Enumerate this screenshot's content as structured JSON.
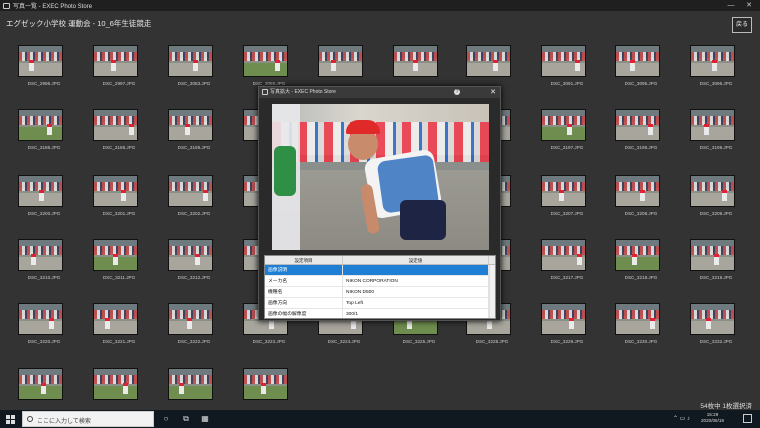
{
  "window": {
    "title": "写真一覧 - EXEC Photo Store",
    "minimize": "—",
    "close": "✕"
  },
  "header": {
    "title": "エグゼック小学校 運動会 - 10_6年生徒競走",
    "close_label": "戻る"
  },
  "thumbnails": [
    {
      "name": "DSC_2996.JPG"
    },
    {
      "name": "DSC_2997.JPG"
    },
    {
      "name": "DSC_3083.JPG"
    },
    {
      "name": "DSC_3085.JPG"
    },
    {
      "name": ""
    },
    {
      "name": ""
    },
    {
      "name": ""
    },
    {
      "name": "DSC_3091.JPG"
    },
    {
      "name": "DSC_3095.JPG"
    },
    {
      "name": "DSC_3096.JPG"
    },
    {
      "name": "DSC_3186.JPG"
    },
    {
      "name": "DSC_3188.JPG"
    },
    {
      "name": "DSC_3189.JPG"
    },
    {
      "name": ""
    },
    {
      "name": ""
    },
    {
      "name": ""
    },
    {
      "name": ""
    },
    {
      "name": "DSC_3197.JPG"
    },
    {
      "name": "DSC_3198.JPG"
    },
    {
      "name": "DSC_3199.JPG"
    },
    {
      "name": "DSC_3200.JPG"
    },
    {
      "name": "DSC_3201.JPG"
    },
    {
      "name": "DSC_3202.JPG"
    },
    {
      "name": ""
    },
    {
      "name": ""
    },
    {
      "name": ""
    },
    {
      "name": ""
    },
    {
      "name": "DSC_3207.JPG"
    },
    {
      "name": "DSC_3208.JPG"
    },
    {
      "name": "DSC_3209.JPG"
    },
    {
      "name": "DSC_3210.JPG"
    },
    {
      "name": "DSC_3211.JPG"
    },
    {
      "name": "DSC_3212.JPG"
    },
    {
      "name": ""
    },
    {
      "name": ""
    },
    {
      "name": ""
    },
    {
      "name": ""
    },
    {
      "name": "DSC_3217.JPG"
    },
    {
      "name": "DSC_3218.JPG"
    },
    {
      "name": "DSC_3219.JPG"
    },
    {
      "name": "DSC_3220.JPG"
    },
    {
      "name": "DSC_3221.JPG"
    },
    {
      "name": "DSC_3222.JPG"
    },
    {
      "name": "DSC_3223.JPG"
    },
    {
      "name": "DSC_3224.JPG"
    },
    {
      "name": "DSC_3225.JPG"
    },
    {
      "name": "DSC_3228.JPG"
    },
    {
      "name": "DSC_3229.JPG"
    },
    {
      "name": "DSC_3230.JPG"
    },
    {
      "name": "DSC_3232.JPG"
    },
    {
      "name": ""
    },
    {
      "name": ""
    },
    {
      "name": ""
    },
    {
      "name": ""
    }
  ],
  "status": "54枚中 1枚選択済",
  "dialog": {
    "title": "写真拡大 - EXEC Photo Store",
    "help": "?",
    "close": "✕",
    "table": {
      "headers": [
        "設定項目",
        "設定値"
      ],
      "rows": [
        {
          "key": "画像説明",
          "value": ""
        },
        {
          "key": "メーカ名",
          "value": "NIKON CORPORATION"
        },
        {
          "key": "機種名",
          "value": "NIKON D500"
        },
        {
          "key": "画像方向",
          "value": "Top Left"
        },
        {
          "key": "画像の幅の解像度",
          "value": "300/1"
        }
      ]
    }
  },
  "taskbar": {
    "search_placeholder": "ここに入力して検索",
    "time": "15:29",
    "date": "2020/06/19"
  }
}
